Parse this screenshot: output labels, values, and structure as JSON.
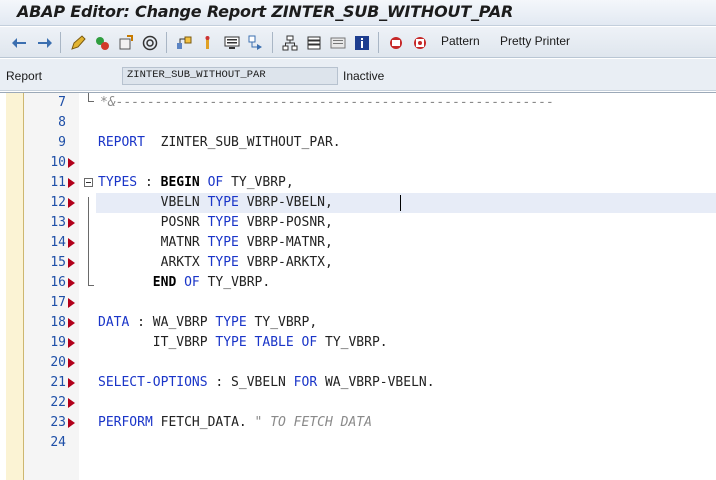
{
  "window": {
    "title": "ABAP Editor: Change Report ZINTER_SUB_WITHOUT_PAR"
  },
  "toolbar": {
    "icons": [
      "back-arrow-icon",
      "forward-arrow-icon",
      "edit-pencil-icon",
      "check-syntax-icon",
      "activate-icon",
      "test-run-icon",
      "where-used-icon",
      "object-list-icon",
      "display-object-icon",
      "navigation-icon",
      "breakpoint-icon",
      "hierarchy-icon",
      "help-icon",
      "info-icon",
      "pattern-icon",
      "pretty-printer-icon"
    ],
    "pattern_label": "Pattern",
    "pretty_printer_label": "Pretty Printer"
  },
  "info": {
    "label": "Report",
    "program_name": "ZINTER_SUB_WITHOUT_PAR",
    "status": "Inactive"
  },
  "editor": {
    "lines": [
      {
        "num": "7",
        "text": "*&--------------------------------------------------------"
      },
      {
        "num": "8",
        "text": ""
      },
      {
        "num": "9",
        "text": "REPORT  ZINTER_SUB_WITHOUT_PAR."
      },
      {
        "num": "10",
        "text": ""
      },
      {
        "num": "11",
        "text": "TYPES : BEGIN OF TY_VBRP,"
      },
      {
        "num": "12",
        "text": "        VBELN TYPE VBRP-VBELN,"
      },
      {
        "num": "13",
        "text": "        POSNR TYPE VBRP-POSNR,"
      },
      {
        "num": "14",
        "text": "        MATNR TYPE VBRP-MATNR,"
      },
      {
        "num": "15",
        "text": "        ARKTX TYPE VBRP-ARKTX,"
      },
      {
        "num": "16",
        "text": "       END OF TY_VBRP."
      },
      {
        "num": "17",
        "text": ""
      },
      {
        "num": "18",
        "text": "DATA : WA_VBRP TYPE TY_VBRP,"
      },
      {
        "num": "19",
        "text": "       IT_VBRP TYPE TABLE OF TY_VBRP."
      },
      {
        "num": "20",
        "text": ""
      },
      {
        "num": "21",
        "text": "SELECT-OPTIONS : S_VBELN FOR WA_VBRP-VBELN."
      },
      {
        "num": "22",
        "text": ""
      },
      {
        "num": "23",
        "text": "PERFORM FETCH_DATA. \" TO FETCH DATA"
      },
      {
        "num": "24",
        "text": ""
      }
    ]
  },
  "colors": {
    "keyword": "#1a35c8",
    "line_number": "#1e4fa7",
    "comment": "#8a8a8a",
    "marker_arrow": "#b2001a",
    "highlight_line": "#e7ecf7"
  }
}
